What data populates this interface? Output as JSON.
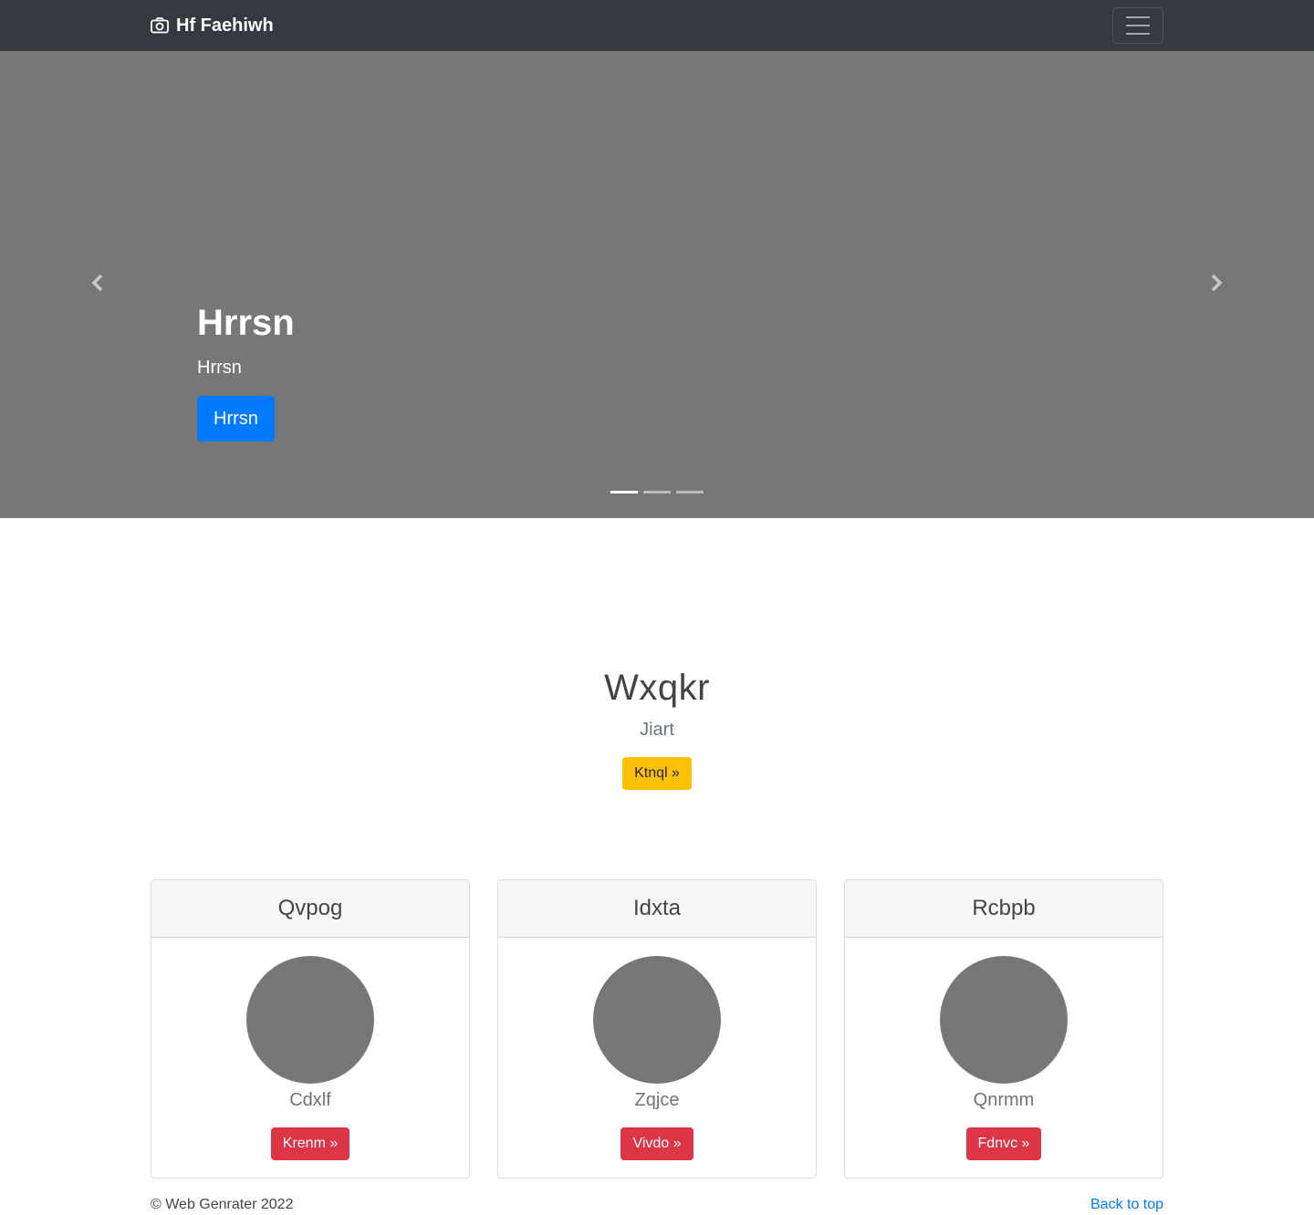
{
  "navbar": {
    "brand": "Hf Faehiwh",
    "brand_icon": "camera-icon",
    "toggler_icon": "hamburger-menu-icon"
  },
  "carousel": {
    "title": "Hrrsn",
    "text": "Hrrsn",
    "button_label": "Hrrsn",
    "prev_icon": "chevron-left-icon",
    "next_icon": "chevron-right-icon",
    "indicator_count": 3,
    "active_index": 0
  },
  "hero": {
    "title": "Wxqkr",
    "subtitle": "Jiart",
    "button_label": "Ktnql »"
  },
  "cards": [
    {
      "title": "Qvpog",
      "name": "Cdxlf",
      "button_label": "Krenm »"
    },
    {
      "title": "Idxta",
      "name": "Zqjce",
      "button_label": "Vivdo »"
    },
    {
      "title": "Rcbpb",
      "name": "Qnrmm",
      "button_label": "Fdnvc »"
    }
  ],
  "footer": {
    "copyright": "© Web Genrater 2022",
    "back_to_top": "Back to top"
  },
  "colors": {
    "navbar_bg": "#343a40",
    "placeholder_gray": "#777777",
    "primary": "#007bff",
    "warning": "#ffc107",
    "danger": "#dc3545"
  }
}
